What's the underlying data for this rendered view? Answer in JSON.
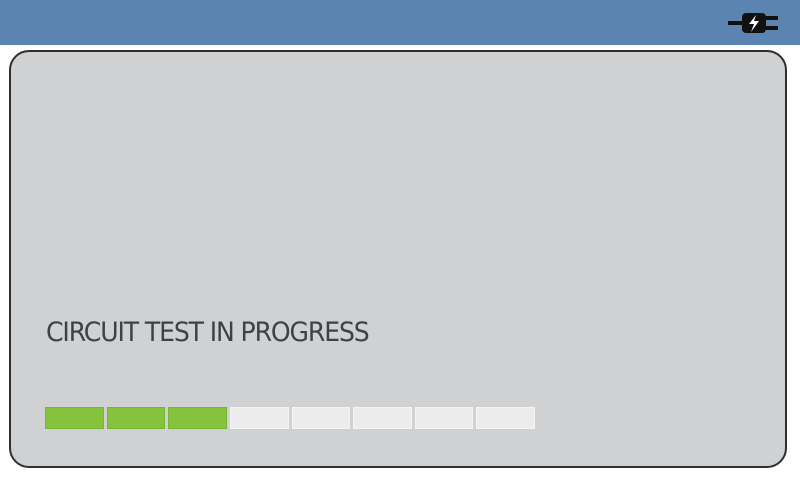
{
  "header": {
    "icon": "power-plug-icon",
    "background_color": "#5b84b1"
  },
  "status": {
    "message": "CIRCUIT TEST IN PROGRESS"
  },
  "progress": {
    "segments_total": 8,
    "segments_complete": 3,
    "fraction_complete": 0.375,
    "complete_color": "#86c33d",
    "pending_color": "#ececec"
  }
}
